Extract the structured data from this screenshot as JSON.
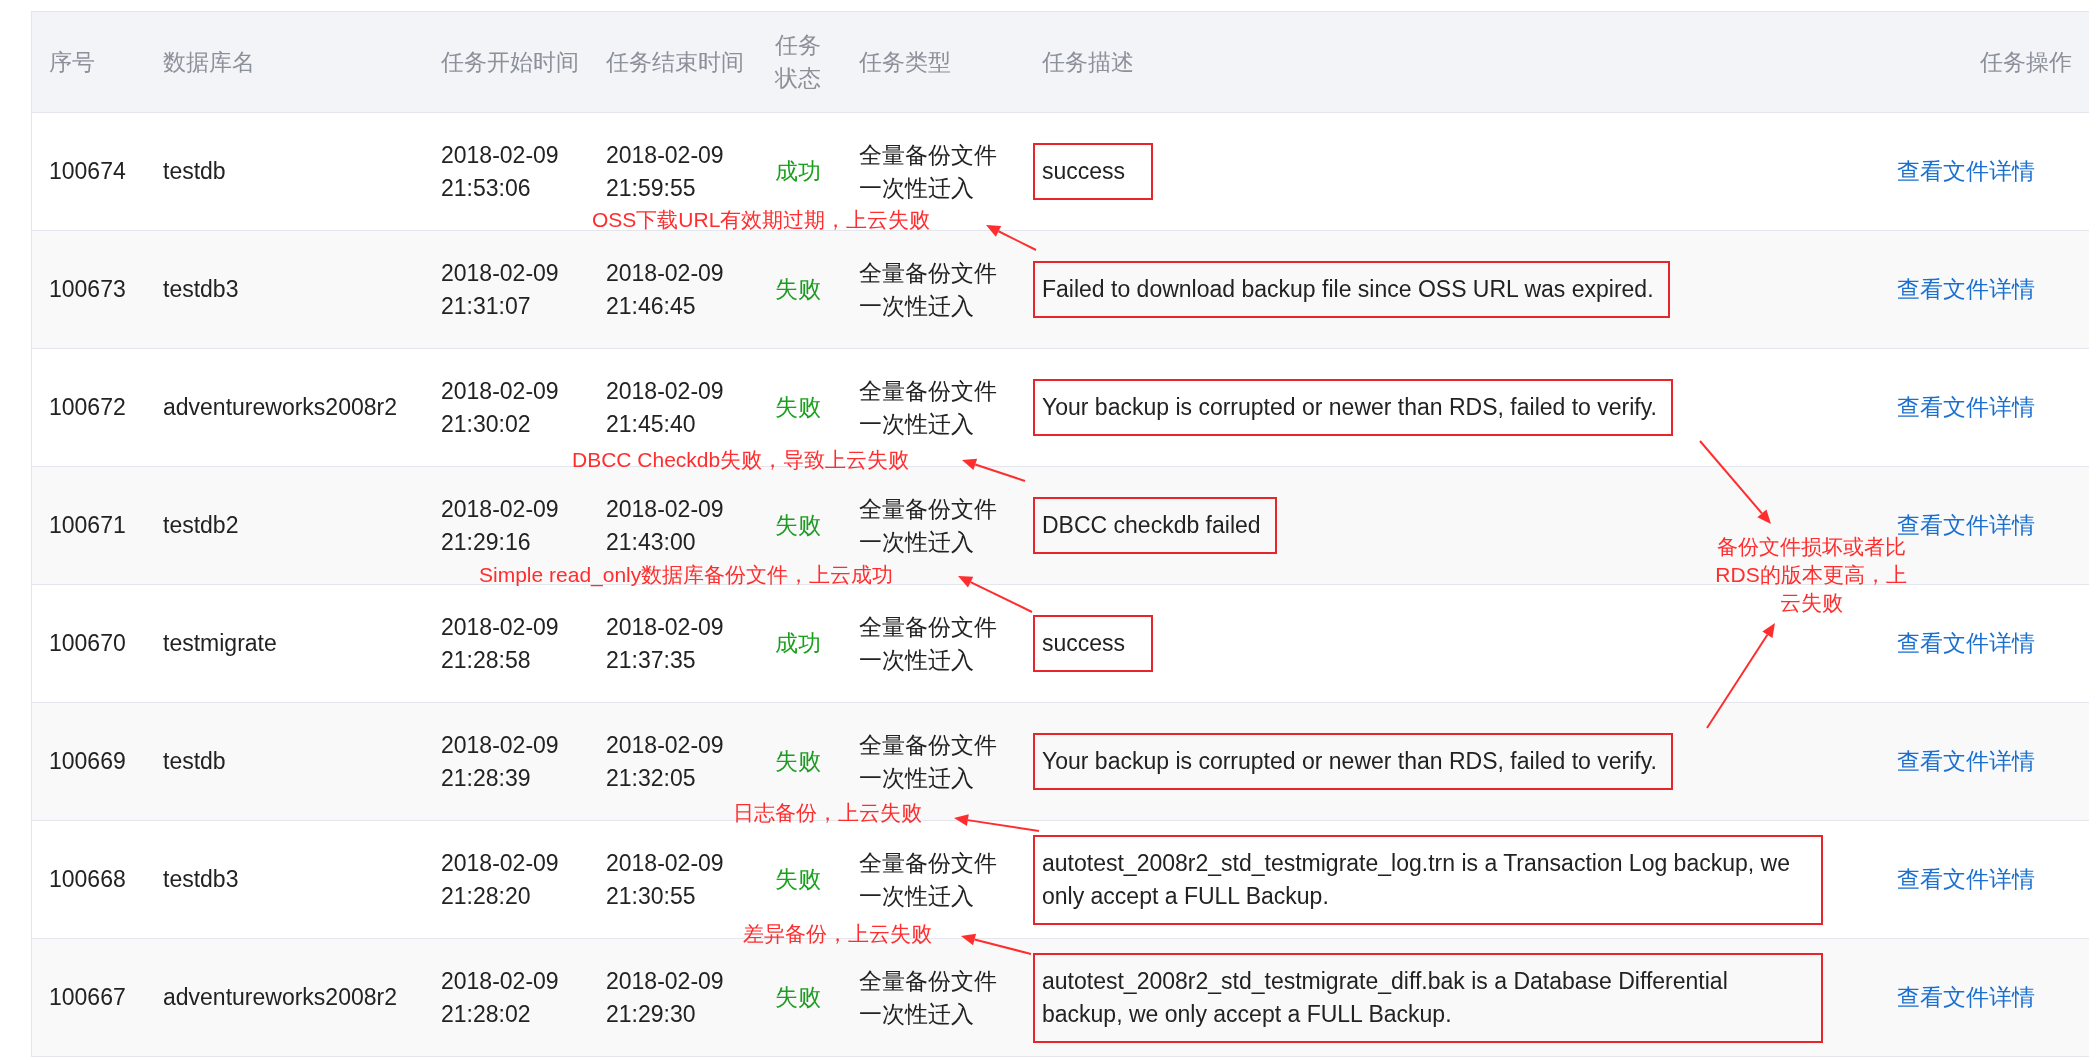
{
  "table": {
    "columns": [
      "序号",
      "数据库名",
      "任务开始时间",
      "任务结束时间",
      "任务状态",
      "任务类型",
      "任务描述",
      "任务操作"
    ],
    "rows": [
      {
        "id": "100674",
        "database": "testdb",
        "start": [
          "2018-02-09",
          "21:53:06"
        ],
        "end": [
          "2018-02-09",
          "21:59:55"
        ],
        "status": "成功",
        "type": [
          "全量备份文件",
          "一次性迁入"
        ],
        "description": "success",
        "action": "查看文件详情"
      },
      {
        "id": "100673",
        "database": "testdb3",
        "start": [
          "2018-02-09",
          "21:31:07"
        ],
        "end": [
          "2018-02-09",
          "21:46:45"
        ],
        "status": "失败",
        "type": [
          "全量备份文件",
          "一次性迁入"
        ],
        "description": "Failed to download backup file since OSS URL was expired.",
        "action": "查看文件详情"
      },
      {
        "id": "100672",
        "database": "adventureworks2008r2",
        "start": [
          "2018-02-09",
          "21:30:02"
        ],
        "end": [
          "2018-02-09",
          "21:45:40"
        ],
        "status": "失败",
        "type": [
          "全量备份文件",
          "一次性迁入"
        ],
        "description": "Your backup is corrupted or newer than RDS, failed to verify.",
        "action": "查看文件详情"
      },
      {
        "id": "100671",
        "database": "testdb2",
        "start": [
          "2018-02-09",
          "21:29:16"
        ],
        "end": [
          "2018-02-09",
          "21:43:00"
        ],
        "status": "失败",
        "type": [
          "全量备份文件",
          "一次性迁入"
        ],
        "description": "DBCC checkdb failed",
        "action": "查看文件详情"
      },
      {
        "id": "100670",
        "database": "testmigrate",
        "start": [
          "2018-02-09",
          "21:28:58"
        ],
        "end": [
          "2018-02-09",
          "21:37:35"
        ],
        "status": "成功",
        "type": [
          "全量备份文件",
          "一次性迁入"
        ],
        "description": "success",
        "action": "查看文件详情"
      },
      {
        "id": "100669",
        "database": "testdb",
        "start": [
          "2018-02-09",
          "21:28:39"
        ],
        "end": [
          "2018-02-09",
          "21:32:05"
        ],
        "status": "失败",
        "type": [
          "全量备份文件",
          "一次性迁入"
        ],
        "description": "Your backup is corrupted or newer than RDS, failed to verify.",
        "action": "查看文件详情"
      },
      {
        "id": "100668",
        "database": "testdb3",
        "start": [
          "2018-02-09",
          "21:28:20"
        ],
        "end": [
          "2018-02-09",
          "21:30:55"
        ],
        "status": "失败",
        "type": [
          "全量备份文件",
          "一次性迁入"
        ],
        "description": "autotest_2008r2_std_testmigrate_log.trn is a Transaction Log backup, we only accept a FULL Backup.",
        "action": "查看文件详情"
      },
      {
        "id": "100667",
        "database": "adventureworks2008r2",
        "start": [
          "2018-02-09",
          "21:28:02"
        ],
        "end": [
          "2018-02-09",
          "21:29:30"
        ],
        "status": "失败",
        "type": [
          "全量备份文件",
          "一次性迁入"
        ],
        "description": "autotest_2008r2_std_testmigrate_diff.bak is a Database Differential backup, we only accept a FULL Backup.",
        "action": "查看文件详情"
      }
    ]
  },
  "annotations": [
    {
      "text": "OSS下载URL有效期过期，上云失败"
    },
    {
      "text": "DBCC Checkdb失败，导致上云失败"
    },
    {
      "text": "Simple read_only数据库备份文件，上云成功"
    },
    {
      "text": "备份文件损坏或者比RDS的版本更高，上云失败"
    },
    {
      "text": "日志备份，上云失败"
    },
    {
      "text": "差异备份，上云失败"
    }
  ]
}
